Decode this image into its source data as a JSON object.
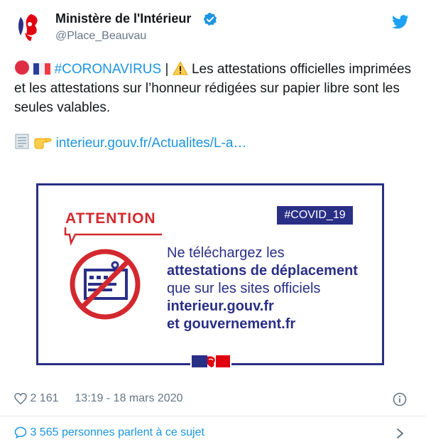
{
  "author": {
    "name": "Ministère de l'Intérieur",
    "handle": "@Place_Beauvau"
  },
  "tweet": {
    "hashtag": "#CORONAVIRUS",
    "separator": " | ",
    "body": " Les attestations officielles imprimées et les attestations sur l’honneur rédigées sur papier libre sont les seules valables.",
    "link": "interieur.gouv.fr/Actualites/L-a…"
  },
  "card": {
    "attention": "ATTENTION",
    "tag": "#COVID_19",
    "lines": [
      "Ne téléchargez les",
      "attestations de déplacement",
      "que sur les sites officiels",
      "interieur.gouv.fr",
      "et gouvernement.fr"
    ]
  },
  "footer": {
    "likes": "2 161",
    "time": "13:19 - 18 mars 2020",
    "talking": "3 565 personnes parlent à ce sujet"
  },
  "colors": {
    "twitter_blue": "#1b95e0",
    "navy": "#2a2f86",
    "red": "#d3282f"
  },
  "icons": [
    "marianne-logo",
    "verified-badge-icon",
    "twitter-bird-icon",
    "red-circle-emoji",
    "french-flag-emoji",
    "warning-emoji",
    "document-emoji",
    "pointing-hand-emoji",
    "heart-icon",
    "info-icon",
    "comment-icon",
    "chevron-right-icon"
  ]
}
